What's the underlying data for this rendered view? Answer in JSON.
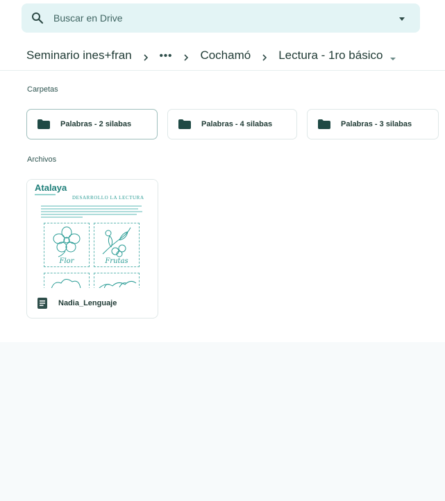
{
  "search": {
    "placeholder": "Buscar en Drive",
    "icon": "search-icon",
    "options_icon": "search-options-icon"
  },
  "breadcrumb": {
    "items": [
      "Seminario ines+fran",
      "•••",
      "Cochamó",
      "Lectura - 1ro básico"
    ],
    "separator_icon": "chevron-right-icon",
    "dropdown_icon": "caret-down-icon"
  },
  "sections": {
    "folders_label": "Carpetas",
    "files_label": "Archivos"
  },
  "folders": [
    {
      "name": "Palabras - 2 silabas",
      "icon": "folder-icon",
      "selected": true
    },
    {
      "name": "Palabras - 4 silabas",
      "icon": "folder-icon",
      "selected": false
    },
    {
      "name": "Palabras - 3 silabas",
      "icon": "folder-icon",
      "selected": false
    }
  ],
  "files": [
    {
      "name": "Nadia_Lenguaje",
      "icon": "google-docs-icon",
      "thumbnail": {
        "brand": "Atalaya",
        "heading": "DESARROLLO LA LECTURA",
        "captions": [
          "Flor",
          "Frutas"
        ]
      }
    }
  ],
  "colors": {
    "accent": "#e3f4f5",
    "text": "#1f3a34",
    "teal": "#2a9c95"
  }
}
